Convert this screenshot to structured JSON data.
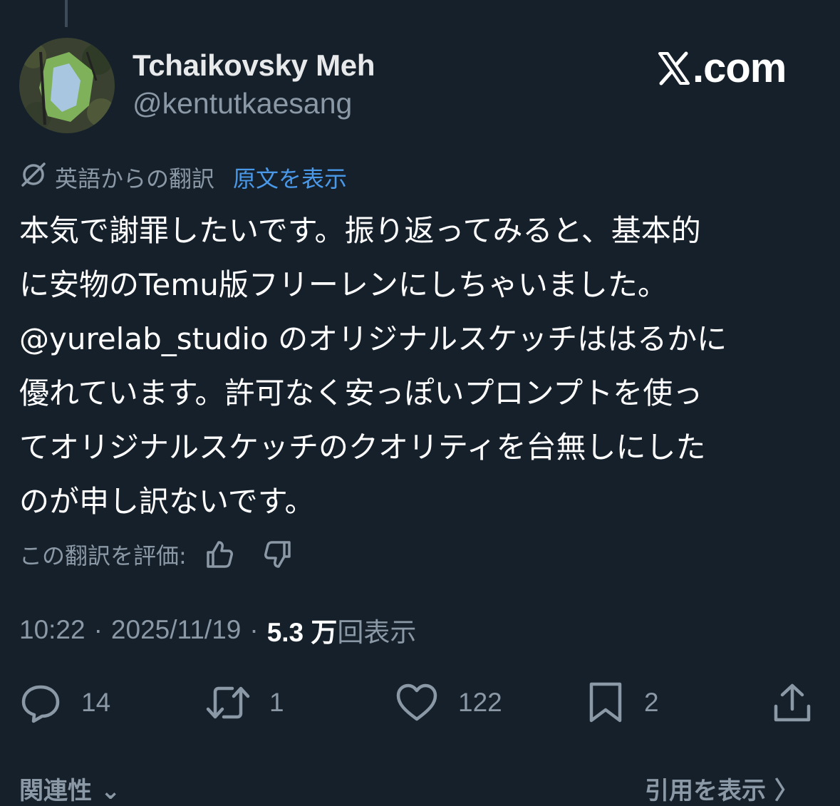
{
  "author": {
    "name": "Tchaikovsky Meh",
    "handle": "@kentutkaesang"
  },
  "brand": {
    "label": ".com",
    "logo_icon": "x-logo-icon"
  },
  "translation": {
    "icon": "translate-icon",
    "translated_from": "英語からの翻訳",
    "show_original": "原文を表示"
  },
  "tweet": {
    "lines": [
      "本気で謝罪したいです。振り返ってみると、基本的",
      "に安物のTemu版フリーレンにしちゃいました。",
      "@yurelab_studio のオリジナルスケッチははるかに",
      "優れています。許可なく安っぽいプロンプトを使っ",
      "てオリジナルスケッチのクオリティを台無しにした",
      "のが申し訳ないです。"
    ]
  },
  "rate": {
    "label": "この翻訳を評価:",
    "up_icon": "thumbs-up-icon",
    "down_icon": "thumbs-down-icon"
  },
  "meta": {
    "time": "10:22",
    "separator": "·",
    "date": "2025/11/19",
    "views_count": "5.3 万",
    "views_label": "回表示"
  },
  "actions": {
    "replies": {
      "icon": "reply-icon",
      "count": "14"
    },
    "reposts": {
      "icon": "repost-icon",
      "count": "1"
    },
    "likes": {
      "icon": "heart-icon",
      "count": "122"
    },
    "bookmarks": {
      "icon": "bookmark-icon",
      "count": "2"
    },
    "share": {
      "icon": "share-icon"
    }
  },
  "bottom": {
    "related": "関連性 ⌄",
    "quotes": "引用を表示 〉"
  },
  "colors": {
    "background": "#15202b",
    "text": "#e7e9ea",
    "secondary": "#8b98a5",
    "link": "#4a99e9"
  }
}
